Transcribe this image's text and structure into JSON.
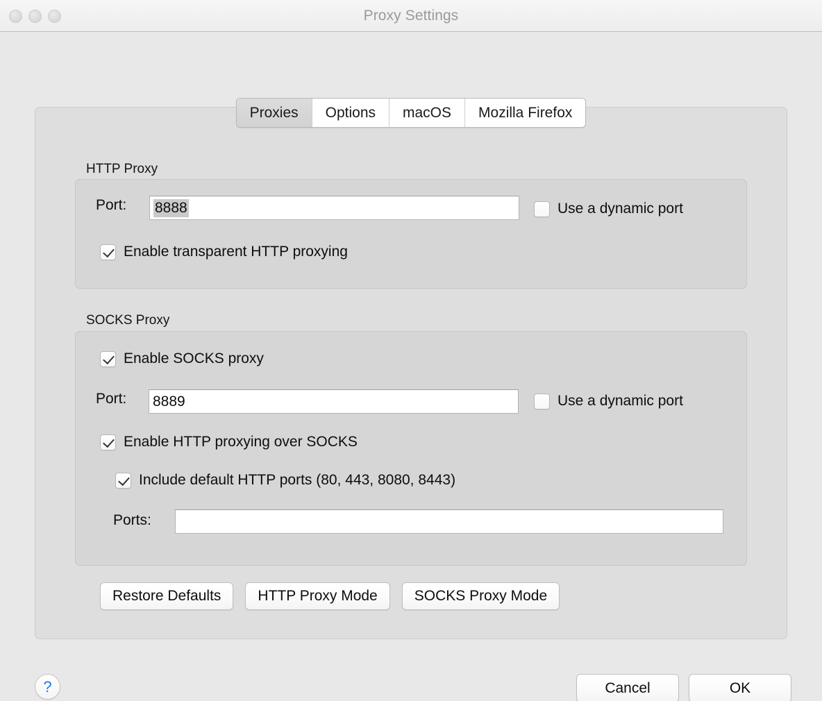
{
  "window": {
    "title": "Proxy Settings",
    "traffic_lights": [
      "close",
      "minimize",
      "zoom"
    ]
  },
  "tabs": [
    {
      "label": "Proxies",
      "selected": true
    },
    {
      "label": "Options",
      "selected": false
    },
    {
      "label": "macOS",
      "selected": false
    },
    {
      "label": "Mozilla Firefox",
      "selected": false
    }
  ],
  "http_proxy": {
    "group_label": "HTTP Proxy",
    "port_label": "Port:",
    "port_value": "8888",
    "port_value_selected": true,
    "dynamic_port_label": "Use a dynamic port",
    "dynamic_port_checked": false,
    "transparent_label": "Enable transparent HTTP proxying",
    "transparent_checked": true
  },
  "socks_proxy": {
    "group_label": "SOCKS Proxy",
    "enable_label": "Enable SOCKS proxy",
    "enable_checked": true,
    "port_label": "Port:",
    "port_value": "8889",
    "dynamic_port_label": "Use a dynamic port",
    "dynamic_port_checked": false,
    "http_over_socks_label": "Enable HTTP proxying over SOCKS",
    "http_over_socks_checked": true,
    "default_ports_label": "Include default HTTP ports (80, 443, 8080, 8443)",
    "default_ports_checked": true,
    "ports_label": "Ports:",
    "ports_value": "",
    "ports_placeholder": ""
  },
  "mode_buttons": {
    "restore_defaults": "Restore Defaults",
    "http_proxy_mode": "HTTP Proxy Mode",
    "socks_proxy_mode": "SOCKS Proxy Mode"
  },
  "footer": {
    "help": "?",
    "cancel": "Cancel",
    "ok": "OK"
  },
  "colors": {
    "titlebar": "#f2f2f2",
    "window_background": "#e8e8e8",
    "panel": "#dededf",
    "groupbox": "#d6d6d6",
    "selection": "#c9c9c9",
    "help_accent": "#1878f0",
    "title_text": "#9a9a9a"
  }
}
